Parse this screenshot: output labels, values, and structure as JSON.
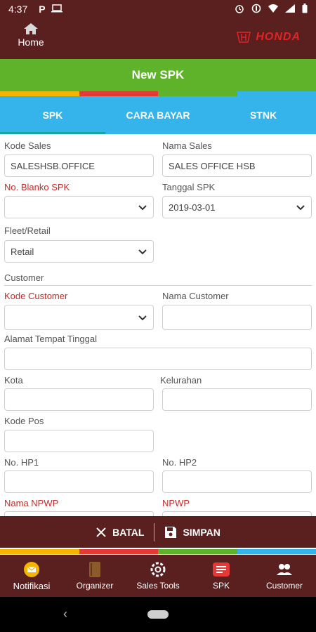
{
  "status_bar": {
    "time": "4:37"
  },
  "header": {
    "home_label": "Home",
    "brand": "HONDA"
  },
  "title": "New SPK",
  "tabs": [
    {
      "label": "SPK",
      "active": true
    },
    {
      "label": "CARA BAYAR",
      "active": false
    },
    {
      "label": "STNK",
      "active": false
    }
  ],
  "form": {
    "kode_sales_label": "Kode Sales",
    "kode_sales_value": "SALESHSB.OFFICE",
    "nama_sales_label": "Nama Sales",
    "nama_sales_value": "SALES OFFICE HSB",
    "no_blanko_label": "No. Blanko SPK",
    "no_blanko_value": "",
    "tanggal_spk_label": "Tanggal SPK",
    "tanggal_spk_value": "2019-03-01",
    "fleet_label": "Fleet/Retail",
    "fleet_value": "Retail",
    "customer_section": "Customer",
    "kode_customer_label": "Kode Customer",
    "kode_customer_value": "",
    "nama_customer_label": "Nama Customer",
    "nama_customer_value": "",
    "alamat_label": "Alamat Tempat Tinggal",
    "alamat_value": "",
    "kota_label": "Kota",
    "kota_value": "",
    "kelurahan_label": "Kelurahan",
    "kelurahan_value": "",
    "kode_pos_label": "Kode Pos",
    "kode_pos_value": "",
    "hp1_label": "No. HP1",
    "hp1_value": "",
    "hp2_label": "No. HP2",
    "hp2_value": "",
    "nama_npwp_label": "Nama NPWP",
    "npwp_label": "NPWP"
  },
  "actions": {
    "cancel_label": "BATAL",
    "save_label": "SIMPAN"
  },
  "bottom_nav": [
    {
      "label": "Notifikasi",
      "icon": "mail-icon"
    },
    {
      "label": "Organizer",
      "icon": "book-icon"
    },
    {
      "label": "Sales Tools",
      "icon": "gear-icon"
    },
    {
      "label": "SPK",
      "icon": "document-icon"
    },
    {
      "label": "Customer",
      "icon": "people-icon"
    }
  ],
  "colors": {
    "header": "#5a1f1f",
    "title_bar": "#5fb32a",
    "tabs": "#34b4ea",
    "required_label": "#c62828",
    "stripe": [
      "#f4b400",
      "#e53935",
      "#5fb32a",
      "#34b4ea"
    ]
  }
}
